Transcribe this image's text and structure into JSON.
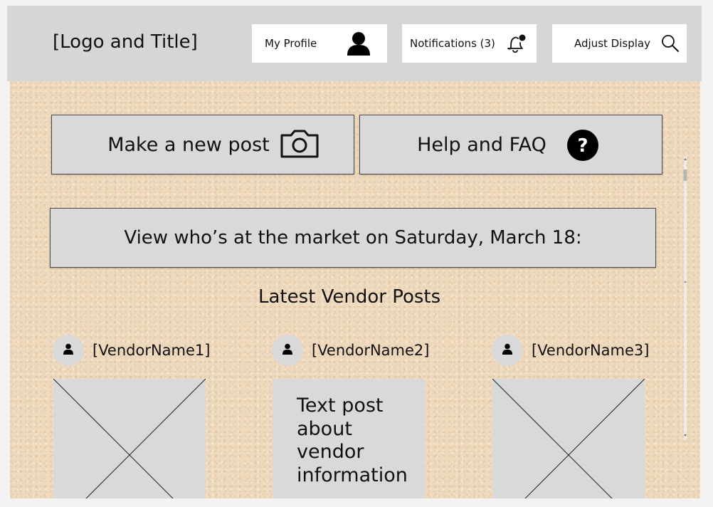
{
  "header": {
    "logo_title": "[Logo and Title]",
    "profile_label": "My Profile",
    "notifications_label": "Notifications (3)",
    "display_label": "Adjust Display"
  },
  "actions": {
    "new_post_label": "Make a new post",
    "help_label": "Help and FAQ"
  },
  "market": {
    "label": "View who’s at the market on Saturday, March 18:"
  },
  "feed": {
    "heading": "Latest Vendor Posts",
    "vendors": [
      {
        "name": "[VendorName1]",
        "post_type": "image"
      },
      {
        "name": "[VendorName2]",
        "post_type": "text",
        "text": "Text post about vendor information"
      },
      {
        "name": "[VendorName3]",
        "post_type": "image"
      }
    ]
  },
  "colors": {
    "header_bg": "#d6d6d6",
    "corkboard_bg": "#efd9bd",
    "button_bg": "#d9d9d9"
  },
  "icons": [
    "user-icon",
    "bell-icon",
    "search-icon",
    "camera-icon",
    "question-circle-icon"
  ]
}
